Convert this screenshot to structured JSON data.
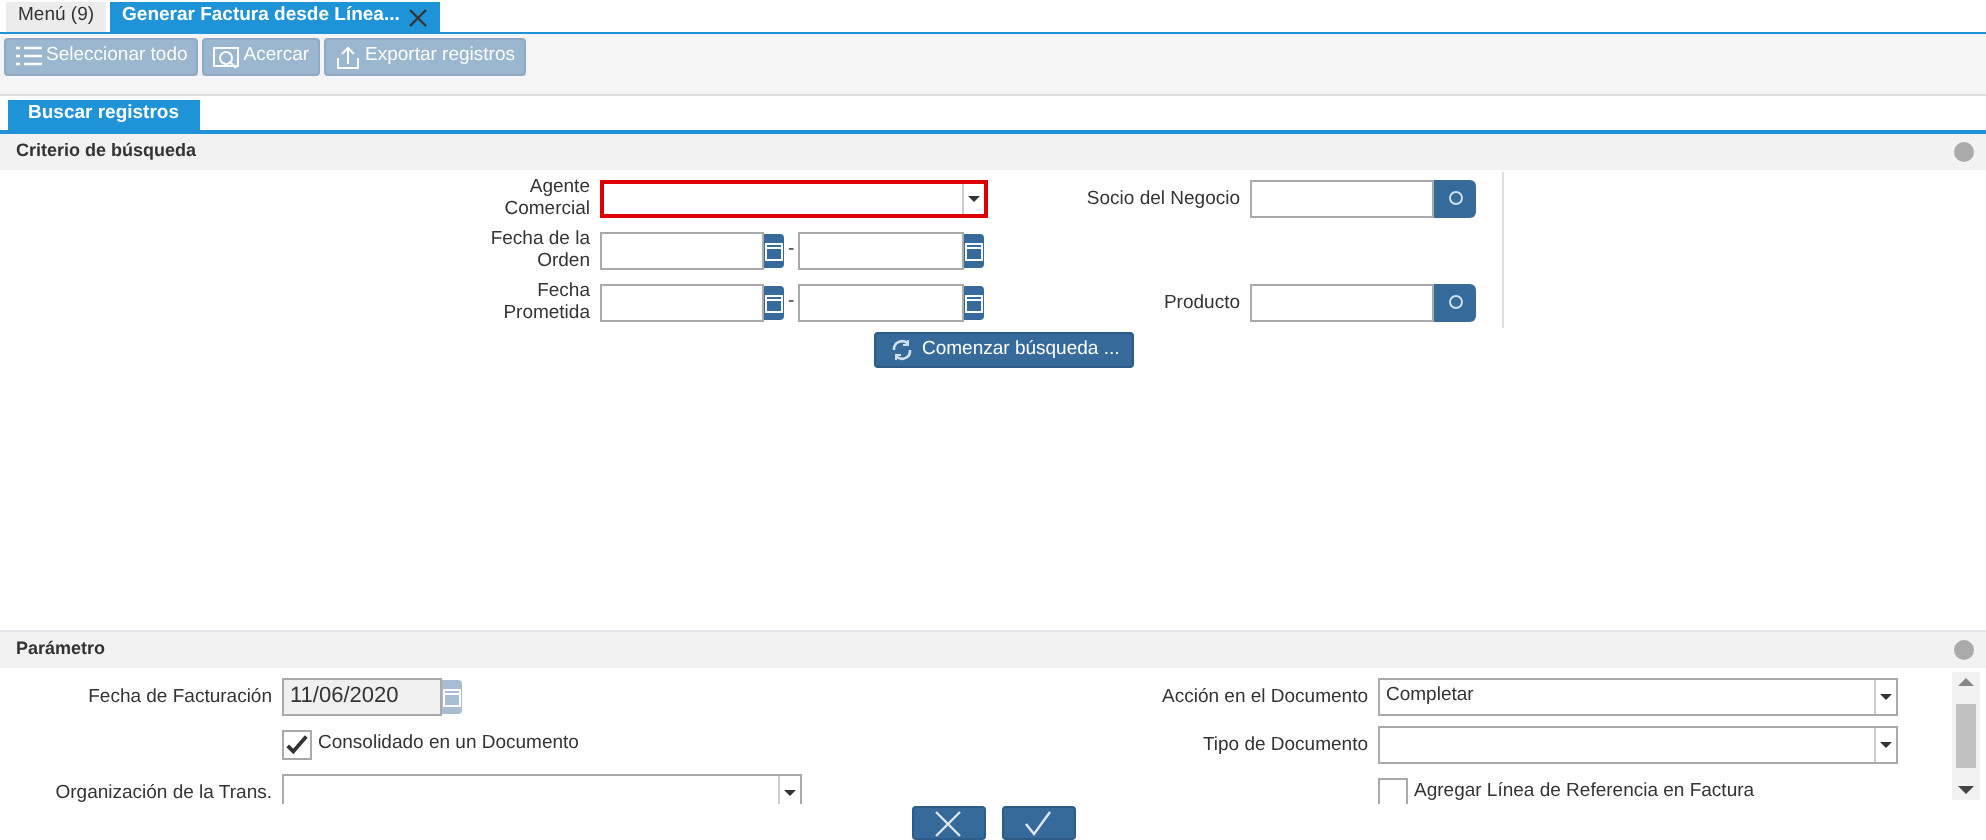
{
  "tabs": [
    {
      "label": "Menú (9)",
      "selected": false,
      "closable": false
    },
    {
      "label": "Generar Factura desde Línea...",
      "selected": true,
      "closable": true
    }
  ],
  "toolbar": [
    {
      "label": "Seleccionar todo",
      "disabled": true
    },
    {
      "label": "Acercar",
      "disabled": true
    },
    {
      "label": "Exportar registros",
      "disabled": true
    }
  ],
  "subtabs": [
    {
      "label": "Buscar registros",
      "selected": true
    }
  ],
  "search": {
    "title": "Criterio de búsqueda",
    "rows": [
      {
        "left": {
          "label": "Agente Comercial",
          "kind": "select",
          "invalid": true
        },
        "right": {
          "label": "Socio del Negocio",
          "kind": "search"
        }
      },
      {
        "left": {
          "label": "Fecha de la Orden",
          "kind": "daterange",
          "separator": "-"
        }
      },
      {
        "left": {
          "label": "Fecha Prometida",
          "kind": "daterange",
          "separator": "-"
        },
        "right": {
          "label": "Producto",
          "kind": "search"
        }
      }
    ],
    "button": "Comenzar búsqueda ..."
  },
  "parameters": {
    "title": "Parámetro",
    "rows": [
      {
        "left": {
          "label": "Fecha de Facturación",
          "kind": "date",
          "value": "11/06/2020"
        },
        "right": {
          "label": "Acción en el Documento",
          "kind": "select",
          "value": "Completar"
        }
      },
      {
        "left": {
          "label": "Consolidado en un Documento",
          "kind": "checkbox",
          "checked": true
        },
        "right": {
          "label": "Tipo de Documento",
          "kind": "select"
        }
      },
      {
        "left": {
          "label": "Organización de la Trans.",
          "kind": "select"
        },
        "right": {
          "label": "Agregar Línea de Referencia en Factura",
          "kind": "checkbox",
          "checked": false
        }
      }
    ]
  },
  "footer": [
    {
      "kind": "cancel"
    },
    {
      "kind": "ok"
    }
  ]
}
